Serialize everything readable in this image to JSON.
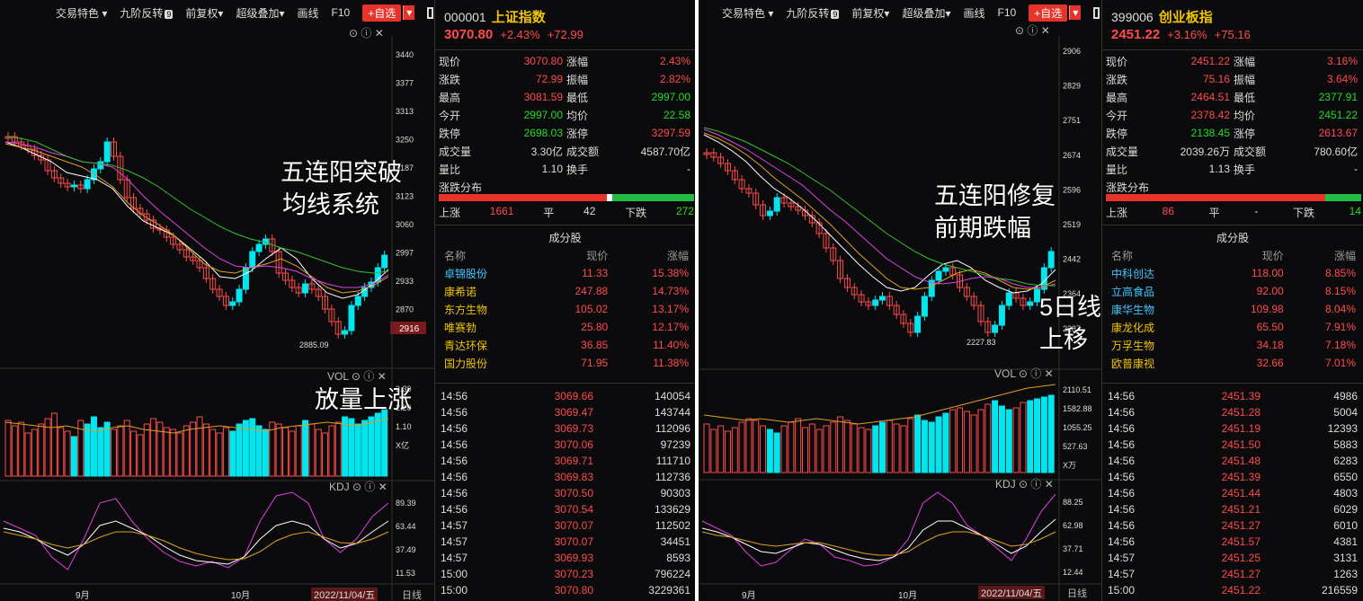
{
  "toolbar": {
    "trade": "交易特色",
    "nine": "九阶反转",
    "nine_badge": "9",
    "fq": "前复权",
    "overlay": "超级叠加",
    "draw": "画线",
    "f10": "F10",
    "add": "+自选"
  },
  "left": {
    "code": "000001",
    "name": "上证指数",
    "price": "3070.80",
    "pct": "+2.43%",
    "chg": "+72.99",
    "stats": [
      [
        "现价",
        "3070.80",
        "涨幅",
        "2.43%"
      ],
      [
        "涨跌",
        "72.99",
        "振幅",
        "2.82%"
      ],
      [
        "最高",
        "3081.59",
        "最低",
        "2997.00"
      ],
      [
        "今开",
        "2997.00",
        "均价",
        "22.58"
      ],
      [
        "跌停",
        "2698.03",
        "涨停",
        "3297.59"
      ],
      [
        "成交量",
        "3.30亿",
        "成交额",
        "4587.70亿"
      ],
      [
        "量比",
        "1.10",
        "换手",
        "-"
      ]
    ],
    "dist_label": "涨跌分布",
    "up_label": "上涨",
    "up": "1661",
    "flat_label": "平",
    "flat": "42",
    "down_label": "下跌",
    "down": "272",
    "comp_title": "成分股",
    "comp_head": [
      "名称",
      "现价",
      "涨幅"
    ],
    "components": [
      [
        "卓锦股份",
        "11.33",
        "15.38%"
      ],
      [
        "康希诺",
        "247.88",
        "14.73%"
      ],
      [
        "东方生物",
        "105.02",
        "13.17%"
      ],
      [
        "唯赛勃",
        "25.80",
        "12.17%"
      ],
      [
        "青达环保",
        "36.85",
        "11.40%"
      ],
      [
        "国力股份",
        "71.95",
        "11.38%"
      ]
    ],
    "ticks": [
      [
        "14:56",
        "3069.66",
        "140054"
      ],
      [
        "14:56",
        "3069.47",
        "143744"
      ],
      [
        "14:56",
        "3069.73",
        "112096"
      ],
      [
        "14:56",
        "3070.06",
        "97239"
      ],
      [
        "14:56",
        "3069.71",
        "111710"
      ],
      [
        "14:56",
        "3069.83",
        "112736"
      ],
      [
        "14:56",
        "3070.50",
        "90303"
      ],
      [
        "14:56",
        "3070.54",
        "133629"
      ],
      [
        "14:57",
        "3070.07",
        "112502"
      ],
      [
        "14:57",
        "3070.07",
        "34451"
      ],
      [
        "14:57",
        "3069.93",
        "8593"
      ],
      [
        "15:00",
        "3070.23",
        "796224"
      ],
      [
        "15:00",
        "3070.80",
        "3229361"
      ]
    ],
    "price_axis": [
      "3440",
      "3377",
      "3313",
      "3250",
      "3187",
      "3123",
      "3060",
      "2997",
      "2933",
      "2870"
    ],
    "cur_price_tag": "2916",
    "low_label": "2885.09",
    "vol_label": "VOL",
    "vol_axis": [
      "3.30",
      "2.20",
      "1.10",
      "X亿"
    ],
    "kdj_label": "KDJ",
    "kdj_axis": [
      "89.39",
      "63.44",
      "37.49",
      "11.53"
    ],
    "months": [
      "9月",
      "10月"
    ],
    "date_label": "2022/11/04/五",
    "period": "日线",
    "annot1": "五连阳突破",
    "annot2": "均线系统",
    "annot3": "放量上涨"
  },
  "right": {
    "code": "399006",
    "name": "创业板指",
    "price": "2451.22",
    "pct": "+3.16%",
    "chg": "+75.16",
    "stats": [
      [
        "现价",
        "2451.22",
        "涨幅",
        "3.16%"
      ],
      [
        "涨跌",
        "75.16",
        "振幅",
        "3.64%"
      ],
      [
        "最高",
        "2464.51",
        "最低",
        "2377.91"
      ],
      [
        "今开",
        "2378.42",
        "均价",
        "2451.22"
      ],
      [
        "跌停",
        "2138.45",
        "涨停",
        "2613.67"
      ],
      [
        "成交量",
        "2039.26万",
        "成交额",
        "780.60亿"
      ],
      [
        "量比",
        "1.13",
        "换手",
        "-"
      ]
    ],
    "dist_label": "涨跌分布",
    "up_label": "上涨",
    "up": "86",
    "flat_label": "平",
    "flat": "-",
    "down_label": "下跌",
    "down": "14",
    "comp_title": "成分股",
    "comp_head": [
      "名称",
      "现价",
      "涨幅"
    ],
    "components": [
      [
        "中科创达",
        "118.00",
        "8.85%"
      ],
      [
        "立高食品",
        "92.00",
        "8.15%"
      ],
      [
        "康华生物",
        "109.98",
        "8.04%"
      ],
      [
        "康龙化成",
        "65.50",
        "7.91%"
      ],
      [
        "万孚生物",
        "34.18",
        "7.18%"
      ],
      [
        "欧普康视",
        "32.66",
        "7.01%"
      ]
    ],
    "ticks": [
      [
        "14:56",
        "2451.39",
        "4986"
      ],
      [
        "14:56",
        "2451.28",
        "5004"
      ],
      [
        "14:56",
        "2451.19",
        "12393"
      ],
      [
        "14:56",
        "2451.50",
        "5883"
      ],
      [
        "14:56",
        "2451.48",
        "6283"
      ],
      [
        "14:56",
        "2451.39",
        "6550"
      ],
      [
        "14:56",
        "2451.44",
        "4803"
      ],
      [
        "14:56",
        "2451.21",
        "6029"
      ],
      [
        "14:56",
        "2451.27",
        "6010"
      ],
      [
        "14:56",
        "2451.57",
        "4381"
      ],
      [
        "14:57",
        "2451.25",
        "3131"
      ],
      [
        "14:57",
        "2451.27",
        "1263"
      ],
      [
        "15:00",
        "2451.22",
        "216559"
      ]
    ],
    "price_axis": [
      "2906",
      "2829",
      "2751",
      "2674",
      "2596",
      "2519",
      "2442",
      "2364",
      "2287"
    ],
    "low_label": "2227.83",
    "vol_label": "VOL",
    "vol_axis": [
      "2110.51",
      "1582.88",
      "1055.25",
      "527.63",
      "X万"
    ],
    "kdj_label": "KDJ",
    "kdj_axis": [
      "88.25",
      "62.98",
      "37.71",
      "12.44"
    ],
    "months": [
      "9月",
      "10月"
    ],
    "date_label": "2022/11/04/五",
    "period": "日线",
    "annot1": "五连阳修复",
    "annot2": "前期跌幅",
    "annot3": "5日线",
    "annot4": "上移"
  },
  "colors": {
    "up": "#ff4b4b",
    "down": "#00e5ee",
    "ma5": "#ffffff",
    "ma10": "#e0a020",
    "ma20": "#e040e0",
    "ma60": "#30c030"
  }
}
